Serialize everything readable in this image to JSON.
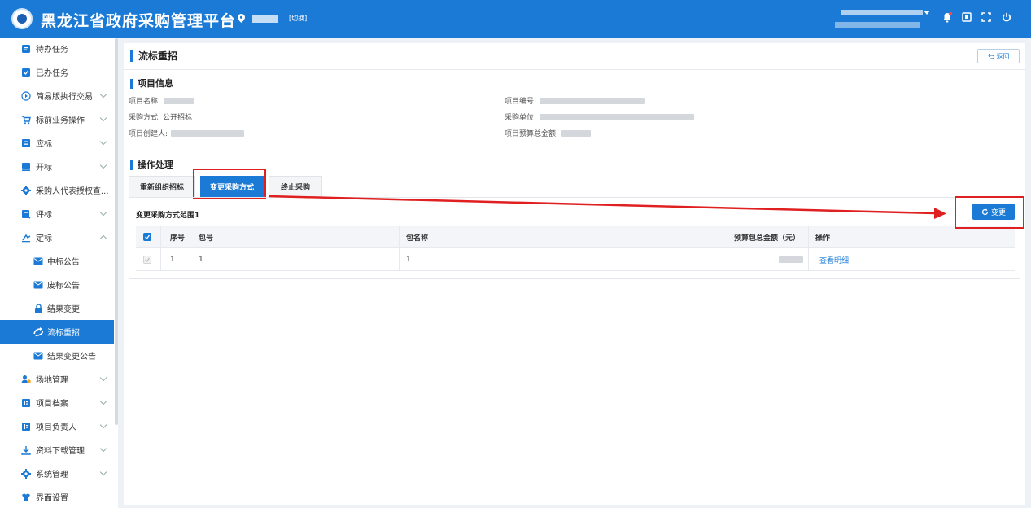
{
  "header": {
    "title": "黑龙江省政府采购管理平台",
    "switch_label": "[切换]"
  },
  "sidebar": {
    "items": [
      {
        "label": "待办任务",
        "icon": "todo-icon"
      },
      {
        "label": "已办任务",
        "icon": "done-icon"
      },
      {
        "label": "简易版执行交易",
        "icon": "play-circle-icon"
      },
      {
        "label": "标前业务操作",
        "icon": "cart-icon"
      },
      {
        "label": "应标",
        "icon": "bid-icon"
      },
      {
        "label": "开标",
        "icon": "open-bid-icon"
      },
      {
        "label": "采购人代表授权查...",
        "icon": "gear-icon"
      },
      {
        "label": "评标",
        "icon": "evaluate-icon"
      },
      {
        "label": "定标",
        "icon": "award-icon"
      },
      {
        "label": "中标公告",
        "icon": "mail-icon"
      },
      {
        "label": "废标公告",
        "icon": "mail-icon"
      },
      {
        "label": "结果变更",
        "icon": "lock-icon"
      },
      {
        "label": "流标重招",
        "icon": "retender-icon"
      },
      {
        "label": "结果变更公告",
        "icon": "mail-icon"
      },
      {
        "label": "场地管理",
        "icon": "venue-icon"
      },
      {
        "label": "项目档案",
        "icon": "archive-icon"
      },
      {
        "label": "项目负责人",
        "icon": "person-card-icon"
      },
      {
        "label": "资料下载管理",
        "icon": "download-icon"
      },
      {
        "label": "系统管理",
        "icon": "gear-icon"
      },
      {
        "label": "界面设置",
        "icon": "shirt-icon"
      }
    ]
  },
  "main": {
    "page_title": "流标重招",
    "back_label": "返回",
    "project_info": {
      "section_title": "项目信息",
      "name_label": "项目名称:",
      "code_label": "项目编号:",
      "method_label": "采购方式:",
      "method_value": "公开招标",
      "unit_label": "采购单位:",
      "creator_label": "项目创建人:",
      "budget_label": "项目预算总金额:"
    },
    "operation": {
      "section_title": "操作处理",
      "tabs": [
        "重新组织招标",
        "变更采购方式",
        "终止采购"
      ],
      "range_label": "变更采购方式范围1",
      "change_label": "变更",
      "table": {
        "headers": [
          "序号",
          "包号",
          "包名称",
          "预算包总金额（元）",
          "操作"
        ],
        "rows": [
          {
            "index": "1",
            "package_no": "1",
            "package_name": "1",
            "action": "查看明细"
          }
        ]
      }
    }
  },
  "colors": {
    "primary": "#1a7ad6",
    "highlight": "#e02020"
  }
}
